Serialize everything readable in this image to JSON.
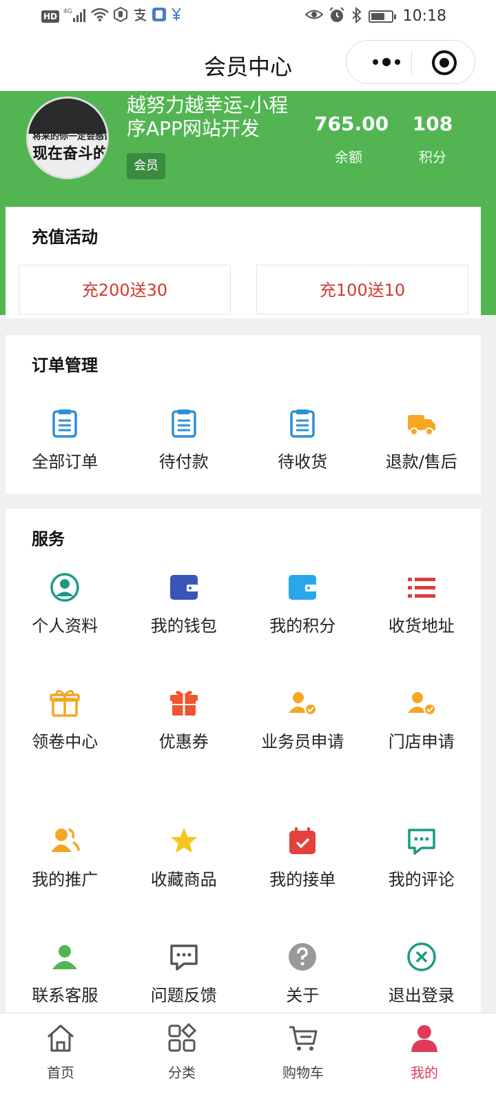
{
  "status_bar": {
    "left_icons": [
      "hd-icon",
      "signal-4g-icon",
      "wifi-icon",
      "hand-icon",
      "alipay-icon",
      "app-icon",
      "yuan-icon"
    ],
    "hd_label": "HD",
    "network": "4G",
    "right_icons": [
      "eye-icon",
      "alarm-icon",
      "bluetooth-icon",
      "battery-icon"
    ],
    "time": "10:18"
  },
  "header": {
    "title": "会员中心"
  },
  "profile": {
    "name": "越努力越幸运-小程序APP网站开发",
    "badge": "会员",
    "avatar_caption_line1": "将来的你一定会感谢",
    "avatar_caption_line2": "现在奋斗的你",
    "stats": [
      {
        "value": "765.00",
        "label": "余额"
      },
      {
        "value": "108",
        "label": "积分"
      }
    ]
  },
  "recharge": {
    "title": "充值活动",
    "options": [
      "充200送30",
      "充100送10"
    ],
    "accent_color": "#d03b2f"
  },
  "orders": {
    "title": "订单管理",
    "items": [
      {
        "label": "全部订单",
        "icon": "order-list-icon"
      },
      {
        "label": "待付款",
        "icon": "order-list-icon"
      },
      {
        "label": "待收货",
        "icon": "order-list-icon"
      },
      {
        "label": "退款/售后",
        "icon": "truck-icon"
      }
    ]
  },
  "services": {
    "title": "服务",
    "items": [
      {
        "label": "个人资料",
        "icon": "user-circle-icon"
      },
      {
        "label": "我的钱包",
        "icon": "wallet-icon"
      },
      {
        "label": "我的积分",
        "icon": "wallet-icon"
      },
      {
        "label": "收货地址",
        "icon": "list-icon"
      },
      {
        "label": "领卷中心",
        "icon": "gift-icon"
      },
      {
        "label": "优惠券",
        "icon": "gift-icon"
      },
      {
        "label": "业务员申请",
        "icon": "user-check-icon"
      },
      {
        "label": "门店申请",
        "icon": "user-check-icon"
      },
      {
        "label": "我的推广",
        "icon": "users-icon"
      },
      {
        "label": "收藏商品",
        "icon": "star-icon"
      },
      {
        "label": "我的接单",
        "icon": "calendar-check-icon"
      },
      {
        "label": "我的评论",
        "icon": "comment-icon"
      },
      {
        "label": "联系客服",
        "icon": "person-icon"
      },
      {
        "label": "问题反馈",
        "icon": "comment-icon"
      },
      {
        "label": "关于",
        "icon": "question-icon"
      },
      {
        "label": "退出登录",
        "icon": "close-circle-icon"
      }
    ]
  },
  "tabbar": {
    "items": [
      {
        "label": "首页",
        "icon": "home-icon"
      },
      {
        "label": "分类",
        "icon": "category-icon"
      },
      {
        "label": "购物车",
        "icon": "cart-icon"
      },
      {
        "label": "我的",
        "icon": "user-icon"
      }
    ],
    "active_index": 3,
    "active_color": "#e03a5a"
  },
  "colors": {
    "brand_green": "#52b552",
    "badge_green": "#3a8a40"
  }
}
